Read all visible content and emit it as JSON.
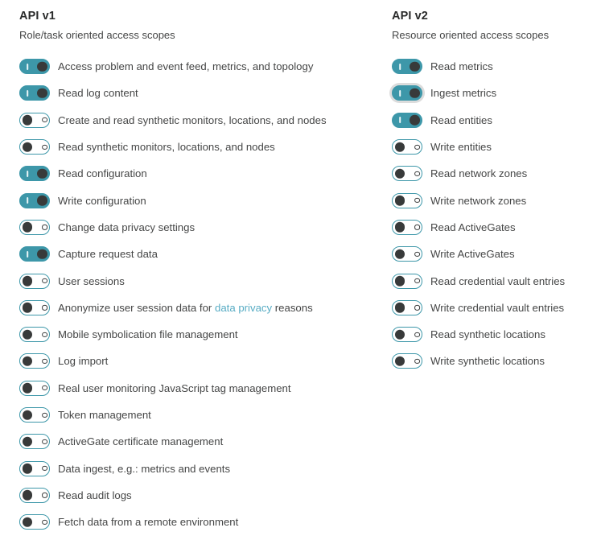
{
  "theme": {
    "accent_teal": "#3d97a9",
    "knob_dark": "#383a3a",
    "text": "#454646",
    "heading": "#2a2b2b",
    "link": "#58acc4",
    "focus_ring": "#dcdcdc",
    "background": "#ffffff"
  },
  "columns": [
    {
      "id": "api-v1",
      "title": "API v1",
      "subtitle": "Role/task oriented access scopes",
      "scopes": [
        {
          "label": "Access problem and event feed, metrics, and topology",
          "state": "on",
          "focused": false
        },
        {
          "label": "Read log content",
          "state": "on",
          "focused": false
        },
        {
          "label": "Create and read synthetic monitors, locations, and nodes",
          "state": "off",
          "focused": false
        },
        {
          "label": "Read synthetic monitors, locations, and nodes",
          "state": "off",
          "focused": false
        },
        {
          "label": "Read configuration",
          "state": "on",
          "focused": false
        },
        {
          "label": "Write configuration",
          "state": "on",
          "focused": false
        },
        {
          "label": "Change data privacy settings",
          "state": "off",
          "focused": false
        },
        {
          "label": "Capture request data",
          "state": "on",
          "focused": false
        },
        {
          "label": "User sessions",
          "state": "off",
          "focused": false
        },
        {
          "label": "Anonymize user session data for ",
          "label_link": "data privacy",
          "label_after": " reasons",
          "state": "off",
          "focused": false
        },
        {
          "label": "Mobile symbolication file management",
          "state": "off",
          "focused": false
        },
        {
          "label": "Log import",
          "state": "off",
          "focused": false
        },
        {
          "label": "Real user monitoring JavaScript tag management",
          "state": "off",
          "focused": false
        },
        {
          "label": "Token management",
          "state": "off",
          "focused": false
        },
        {
          "label": "ActiveGate certificate management",
          "state": "off",
          "focused": false
        },
        {
          "label": "Data ingest, e.g.: metrics and events",
          "state": "off",
          "focused": false
        },
        {
          "label": "Read audit logs",
          "state": "off",
          "focused": false
        },
        {
          "label": "Fetch data from a remote environment",
          "state": "off",
          "focused": false
        }
      ]
    },
    {
      "id": "api-v2",
      "title": "API v2",
      "subtitle": "Resource oriented access scopes",
      "scopes": [
        {
          "label": "Read metrics",
          "state": "on",
          "focused": false
        },
        {
          "label": "Ingest metrics",
          "state": "on",
          "focused": true
        },
        {
          "label": "Read entities",
          "state": "on",
          "focused": false
        },
        {
          "label": "Write entities",
          "state": "off",
          "focused": false
        },
        {
          "label": "Read network zones",
          "state": "off",
          "focused": false
        },
        {
          "label": "Write network zones",
          "state": "off",
          "focused": false
        },
        {
          "label": "Read ActiveGates",
          "state": "off",
          "focused": false
        },
        {
          "label": "Write ActiveGates",
          "state": "off",
          "focused": false
        },
        {
          "label": "Read credential vault entries",
          "state": "off",
          "focused": false
        },
        {
          "label": "Write credential vault entries",
          "state": "off",
          "focused": false
        },
        {
          "label": "Read synthetic locations",
          "state": "off",
          "focused": false
        },
        {
          "label": "Write synthetic locations",
          "state": "off",
          "focused": false
        }
      ]
    }
  ]
}
